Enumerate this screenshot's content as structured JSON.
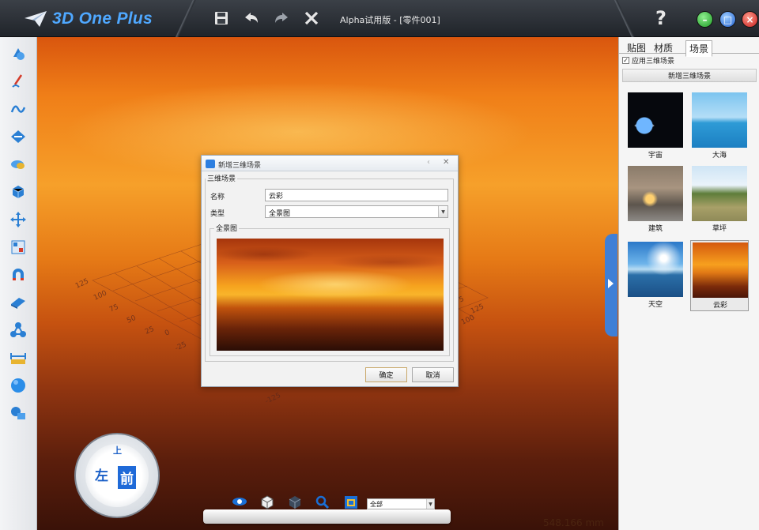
{
  "app": {
    "logo_text": "3D One Plus",
    "window_title": "Alpha试用版 - [零件001]",
    "help_label": "?"
  },
  "toolbar": {
    "icons": [
      "save-icon",
      "undo-icon",
      "redo-icon",
      "close-x-icon"
    ]
  },
  "left_toolbar": {
    "icons": [
      "basic-solid-icon",
      "sketch-icon",
      "curve-icon",
      "special-feature-icon",
      "modify-icon",
      "combine-icon",
      "move-icon",
      "pattern-icon",
      "magnet-icon",
      "surface-icon",
      "assembly-icon",
      "measure-icon",
      "sphere-icon",
      "material-render-icon"
    ]
  },
  "viewport": {
    "grid_labels_left": [
      "125",
      "100",
      "75",
      "50",
      "25",
      "0",
      "-25"
    ],
    "grid_labels_right": [
      "75",
      "100",
      "125"
    ],
    "grid_label_bottom": "-125",
    "measurement": "548.166 mm"
  },
  "dialog": {
    "title": "新增三维场景",
    "group_label": "三维场景",
    "name_label": "名称",
    "name_value": "云彩",
    "type_label": "类型",
    "type_value": "全景图",
    "panorama_label": "全景图",
    "ok_label": "确定",
    "cancel_label": "取消"
  },
  "right_panel": {
    "tabs": [
      {
        "label": "贴图"
      },
      {
        "label": "材质"
      },
      {
        "label": "场景",
        "active": true
      }
    ],
    "apply_3d_label": "应用三维场景",
    "apply_3d_checked": true,
    "new_scene_label": "新增三维场景",
    "scenes": [
      {
        "label": "宇宙"
      },
      {
        "label": "大海"
      },
      {
        "label": "建筑"
      },
      {
        "label": "草坪"
      },
      {
        "label": "天空"
      },
      {
        "label": "云彩",
        "selected": true
      }
    ]
  },
  "viewcube": {
    "left": "左",
    "front": "前",
    "top": "上"
  },
  "bottom_bar": {
    "icons": [
      "eye-icon",
      "cube-outline-icon",
      "cube-solid-icon",
      "zoom-icon",
      "view-box-icon"
    ],
    "filter_value": "全部"
  }
}
